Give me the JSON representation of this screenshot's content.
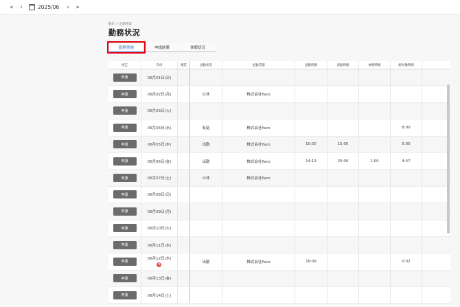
{
  "topbar": {
    "first_icon": "double-chevron-left",
    "prev_icon": "chevron-left",
    "calendar_icon": "calendar",
    "date": "2025/06",
    "next_icon": "chevron-right",
    "last_icon": "double-chevron-right"
  },
  "breadcrumb": "勤怠 > 出勤管理",
  "page_title": "勤務状況",
  "tabs": [
    {
      "label": "勤務実績",
      "active": true
    },
    {
      "label": "申請結果",
      "active": false
    },
    {
      "label": "休暇状況",
      "active": false
    }
  ],
  "table": {
    "headers": [
      "修正",
      "日付",
      "確定",
      "出勤状況",
      "出勤店舗",
      "出勤時間",
      "退勤時間",
      "休憩時間",
      "総労働時間",
      ""
    ],
    "button_label": "申請",
    "rows": [
      {
        "date": "06月01日(日)",
        "status": "",
        "shop": "",
        "in": "",
        "out": "",
        "rest": "",
        "total": "",
        "error": false
      },
      {
        "date": "06月02日(月)",
        "status": "公休",
        "shop": "株式会社flaro",
        "in": "",
        "out": "",
        "rest": "",
        "total": "",
        "error": false
      },
      {
        "date": "06月03日(火)",
        "status": "",
        "shop": "",
        "in": "",
        "out": "",
        "rest": "",
        "total": "",
        "error": false
      },
      {
        "date": "06月04日(水)",
        "status": "有給",
        "shop": "株式会社flaro",
        "in": "",
        "out": "",
        "rest": "",
        "total": "8:00",
        "error": false
      },
      {
        "date": "06月05日(木)",
        "status": "出勤",
        "shop": "株式会社flaro",
        "in": "10:00",
        "out": "15:00",
        "rest": "",
        "total": "5:00",
        "error": false
      },
      {
        "date": "06月06日(金)",
        "status": "出勤",
        "shop": "株式会社flaro",
        "in": "14:13",
        "out": "20:00",
        "rest": "1:00",
        "total": "4:47",
        "error": false
      },
      {
        "date": "06月07日(土)",
        "status": "公休",
        "shop": "株式会社flaro",
        "in": "",
        "out": "",
        "rest": "",
        "total": "",
        "error": false
      },
      {
        "date": "06月08日(日)",
        "status": "",
        "shop": "",
        "in": "",
        "out": "",
        "rest": "",
        "total": "",
        "error": false
      },
      {
        "date": "06月09日(月)",
        "status": "",
        "shop": "",
        "in": "",
        "out": "",
        "rest": "",
        "total": "",
        "error": false
      },
      {
        "date": "06月10日(火)",
        "status": "",
        "shop": "",
        "in": "",
        "out": "",
        "rest": "",
        "total": "",
        "error": false
      },
      {
        "date": "06月11日(水)",
        "status": "",
        "shop": "",
        "in": "",
        "out": "",
        "rest": "",
        "total": "",
        "error": false
      },
      {
        "date": "06月12日(木)",
        "status": "出勤",
        "shop": "株式会社flaro",
        "in": "18:09",
        "out": "",
        "rest": "",
        "total": "0:02",
        "error": true
      },
      {
        "date": "06月13日(金)",
        "status": "",
        "shop": "",
        "in": "",
        "out": "",
        "rest": "",
        "total": "",
        "error": false
      },
      {
        "date": "06月14日(土)",
        "status": "",
        "shop": "",
        "in": "",
        "out": "",
        "rest": "",
        "total": "",
        "error": false
      }
    ]
  },
  "colors": {
    "tab_active": "#3b78c2",
    "highlight": "#e60012",
    "button_bg": "#6b6b6b",
    "error": "#d9534f"
  }
}
